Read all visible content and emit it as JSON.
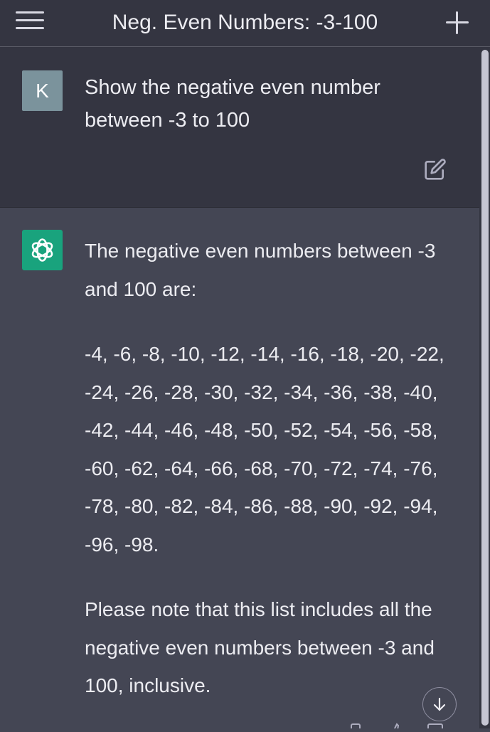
{
  "header": {
    "title": "Neg. Even Numbers: -3-100",
    "menu_icon": "hamburger-menu-icon",
    "new_chat_icon": "plus-icon"
  },
  "user_message": {
    "avatar_initial": "K",
    "avatar_color": "#7b939c",
    "text": "Show the negative even number between -3 to 100",
    "edit_icon": "edit-icon"
  },
  "assistant_message": {
    "logo_icon": "openai-logo-icon",
    "logo_color": "#19a37d",
    "paragraphs": [
      "The negative even numbers between -3 and 100 are:",
      "-4, -6, -8, -10, -12, -14, -16, -18, -20, -22, -24, -26, -28, -30, -32, -34, -36, -38, -40, -42, -44, -46, -48, -50, -52, -54, -56, -58, -60, -62, -64, -66, -68, -70, -72, -74, -76, -78, -80, -82, -84, -86, -88, -90, -92, -94, -96, -98.",
      "Please note that this list includes all the negative even numbers between -3 and 100, inclusive."
    ]
  },
  "scroll_down_icon": "arrow-down-icon",
  "colors": {
    "header_bg": "#343541",
    "assistant_bg": "#444654",
    "text": "#ececf1"
  }
}
